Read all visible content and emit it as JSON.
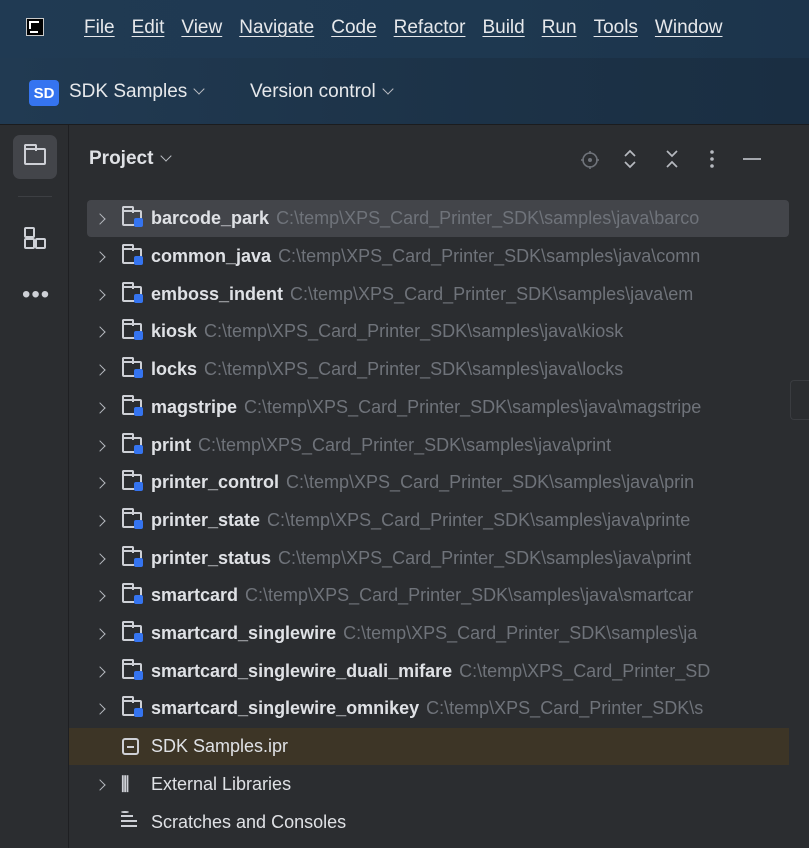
{
  "menu": {
    "items": [
      "File",
      "Edit",
      "View",
      "Navigate",
      "Code",
      "Refactor",
      "Build",
      "Run",
      "Tools",
      "Window"
    ]
  },
  "toolbar": {
    "project_badge": "SD",
    "project_name": "SDK Samples",
    "vcs_label": "Version control"
  },
  "panel": {
    "title": "Project"
  },
  "tree": {
    "modules": [
      {
        "name": "barcode_park",
        "path": "C:\\temp\\XPS_Card_Printer_SDK\\samples\\java\\barco"
      },
      {
        "name": "common_java",
        "path": "C:\\temp\\XPS_Card_Printer_SDK\\samples\\java\\comn"
      },
      {
        "name": "emboss_indent",
        "path": "C:\\temp\\XPS_Card_Printer_SDK\\samples\\java\\em"
      },
      {
        "name": "kiosk",
        "path": "C:\\temp\\XPS_Card_Printer_SDK\\samples\\java\\kiosk"
      },
      {
        "name": "locks",
        "path": "C:\\temp\\XPS_Card_Printer_SDK\\samples\\java\\locks"
      },
      {
        "name": "magstripe",
        "path": "C:\\temp\\XPS_Card_Printer_SDK\\samples\\java\\magstripe"
      },
      {
        "name": "print",
        "path": "C:\\temp\\XPS_Card_Printer_SDK\\samples\\java\\print"
      },
      {
        "name": "printer_control",
        "path": "C:\\temp\\XPS_Card_Printer_SDK\\samples\\java\\prin"
      },
      {
        "name": "printer_state",
        "path": "C:\\temp\\XPS_Card_Printer_SDK\\samples\\java\\printe"
      },
      {
        "name": "printer_status",
        "path": "C:\\temp\\XPS_Card_Printer_SDK\\samples\\java\\print"
      },
      {
        "name": "smartcard",
        "path": "C:\\temp\\XPS_Card_Printer_SDK\\samples\\java\\smartcar"
      },
      {
        "name": "smartcard_singlewire",
        "path": "C:\\temp\\XPS_Card_Printer_SDK\\samples\\ja"
      },
      {
        "name": "smartcard_singlewire_duali_mifare",
        "path": "C:\\temp\\XPS_Card_Printer_SD"
      },
      {
        "name": "smartcard_singlewire_omnikey",
        "path": "C:\\temp\\XPS_Card_Printer_SDK\\s"
      }
    ],
    "ipr_file": "SDK Samples.ipr",
    "external_libraries": "External Libraries",
    "scratches": "Scratches and Consoles"
  }
}
